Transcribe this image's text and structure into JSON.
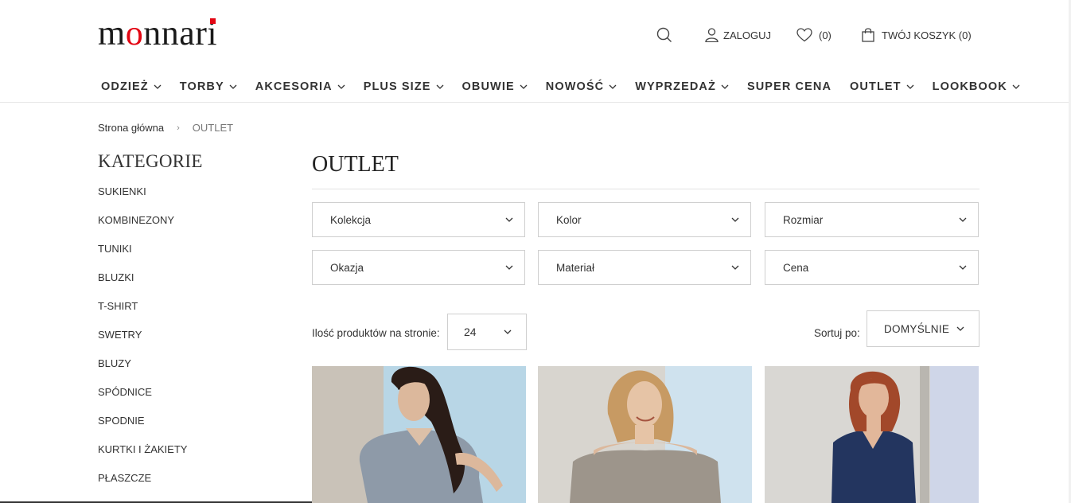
{
  "brand": {
    "logo_text": "monnari",
    "accent": "#e30613"
  },
  "header": {
    "search_icon": "search-icon",
    "login_label": "ZALOGUJ",
    "wishlist_count": "(0)",
    "cart_label": "TWÓJ KOSZYK (0)"
  },
  "nav": {
    "items": [
      {
        "label": "ODZIEŻ",
        "dropdown": true
      },
      {
        "label": "TORBY",
        "dropdown": true
      },
      {
        "label": "AKCESORIA",
        "dropdown": true
      },
      {
        "label": "PLUS SIZE",
        "dropdown": true
      },
      {
        "label": "OBUWIE",
        "dropdown": true
      },
      {
        "label": "NOWOŚĆ",
        "dropdown": true
      },
      {
        "label": "WYPRZEDAŻ",
        "dropdown": true
      },
      {
        "label": "SUPER CENA",
        "dropdown": false
      },
      {
        "label": "OUTLET",
        "dropdown": true
      },
      {
        "label": "LOOKBOOK",
        "dropdown": true
      }
    ]
  },
  "breadcrumb": {
    "home": "Strona główna",
    "separator": "›",
    "current": "OUTLET"
  },
  "sidebar": {
    "title": "KATEGORIE",
    "categories": [
      "SUKIENKI",
      "KOMBINEZONY",
      "TUNIKI",
      "BLUZKI",
      "T-SHIRT",
      "SWETRY",
      "BLUZY",
      "SPÓDNICE",
      "SPODNIE",
      "KURTKI I ŻAKIETY",
      "PŁASZCZE"
    ]
  },
  "main": {
    "title": "OUTLET",
    "filters": [
      "Kolekcja",
      "Kolor",
      "Rozmiar",
      "Okazja",
      "Materiał",
      "Cena"
    ],
    "per_page_label": "Ilość produktów na stronie:",
    "per_page_value": "24",
    "sort_label": "Sortuj po:",
    "sort_value": "DOMYŚLNIE"
  },
  "products": [
    {
      "image": "woman-grey-shirt-dress",
      "bg": "#b8d6e6",
      "garment": "#8e9aa8",
      "hair": "#2a1c17"
    },
    {
      "image": "woman-offshoulder-top",
      "bg": "#cfe2ee",
      "garment": "#9d958b",
      "hair": "#c79a63"
    },
    {
      "image": "woman-navy-sleeveless-top",
      "bg": "#cfd6e8",
      "garment": "#23355f",
      "hair": "#a2482a"
    }
  ]
}
